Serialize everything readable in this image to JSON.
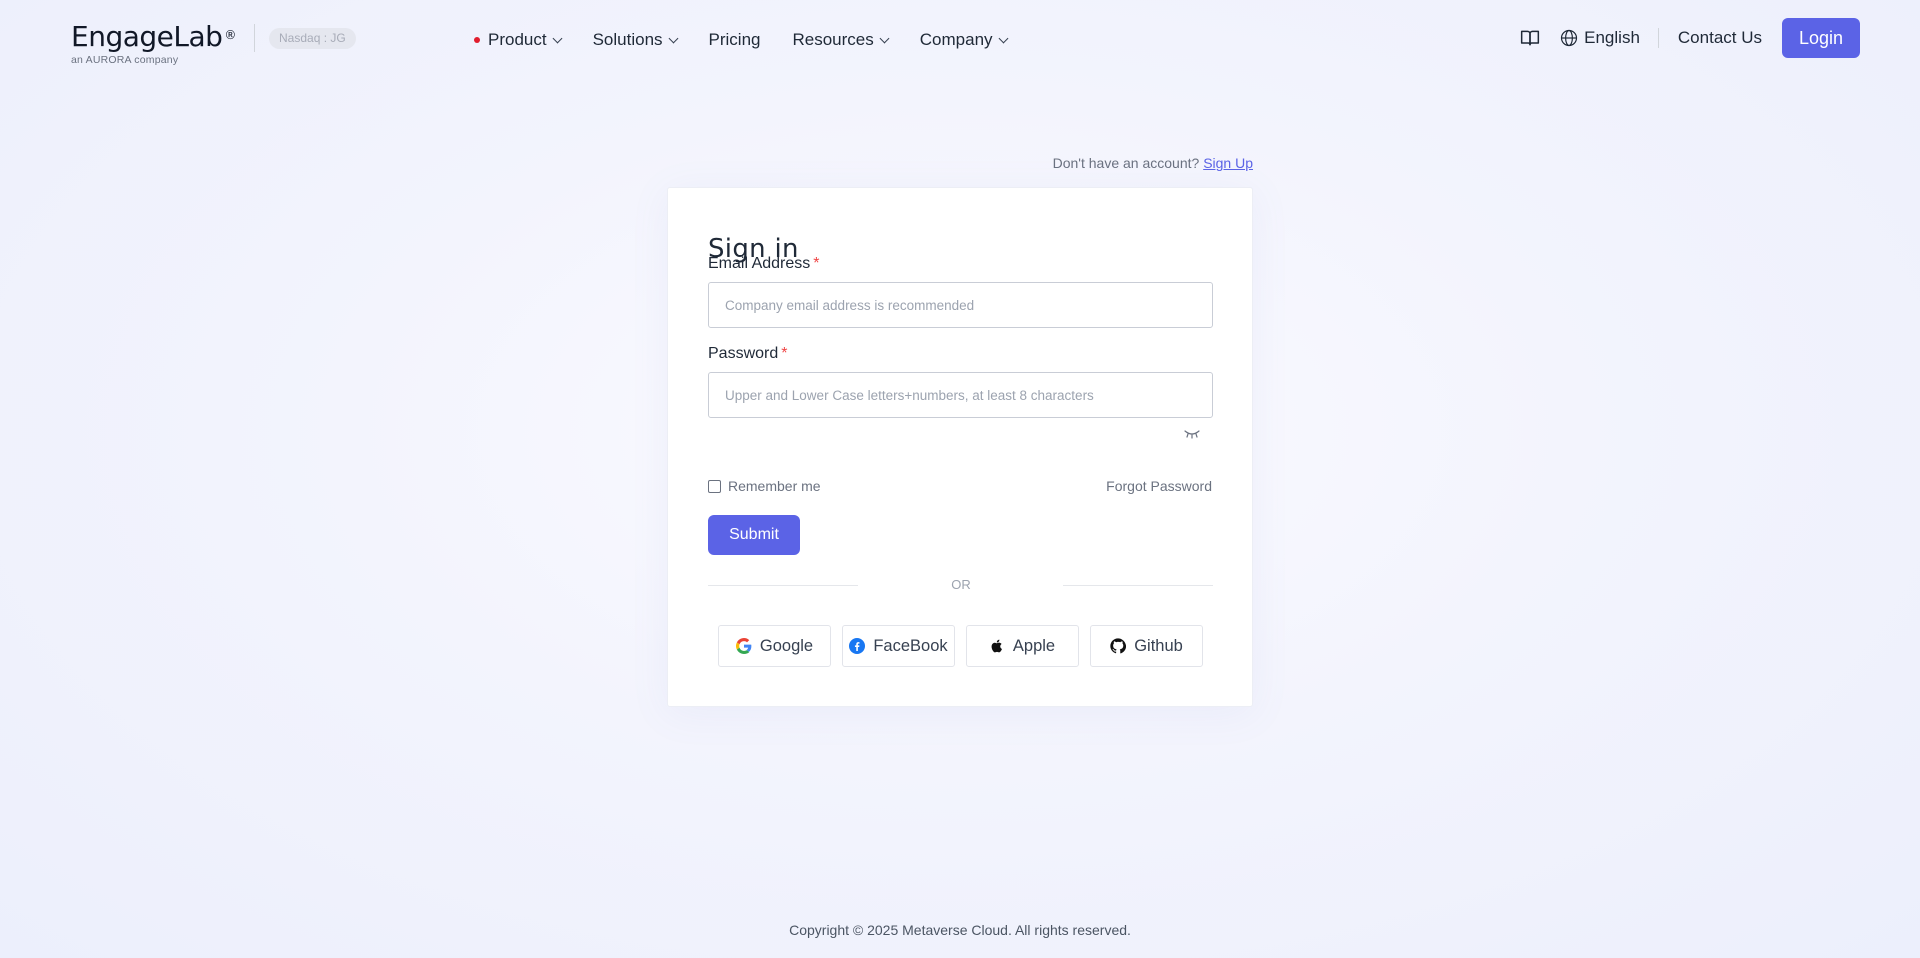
{
  "header": {
    "logo_text": "EngageLab",
    "logo_reg": "®",
    "logo_sub": "an AURORA company",
    "nasdaq": "Nasdaq : JG",
    "nav": [
      {
        "label": "Product",
        "has_dropdown": true,
        "dot": true
      },
      {
        "label": "Solutions",
        "has_dropdown": true
      },
      {
        "label": "Pricing",
        "has_dropdown": false
      },
      {
        "label": "Resources",
        "has_dropdown": true
      },
      {
        "label": "Company",
        "has_dropdown": true
      }
    ],
    "language": "English",
    "contact": "Contact Us",
    "login": "Login"
  },
  "signup_prompt": {
    "text": "Don't have an account?",
    "link": "Sign Up"
  },
  "form": {
    "title": "Sign in",
    "email_label": "Email Address",
    "email_placeholder": "Company email address is recommended",
    "email_value": "",
    "password_label": "Password",
    "password_placeholder": "Upper and Lower Case letters+numbers, at least 8 characters",
    "password_value": "",
    "required_mark": "*",
    "remember_me": "Remember me",
    "remember_checked": false,
    "forgot_password": "Forgot Password",
    "submit": "Submit",
    "or": "OR",
    "social": [
      "Google",
      "FaceBook",
      "Apple",
      "Github"
    ]
  },
  "footer": {
    "copyright": "Copyright © 2025 Metaverse Cloud. All rights reserved."
  },
  "colors": {
    "primary": "#5b63e6",
    "required": "#ef4444",
    "nav_dot": "#e11d2e"
  }
}
